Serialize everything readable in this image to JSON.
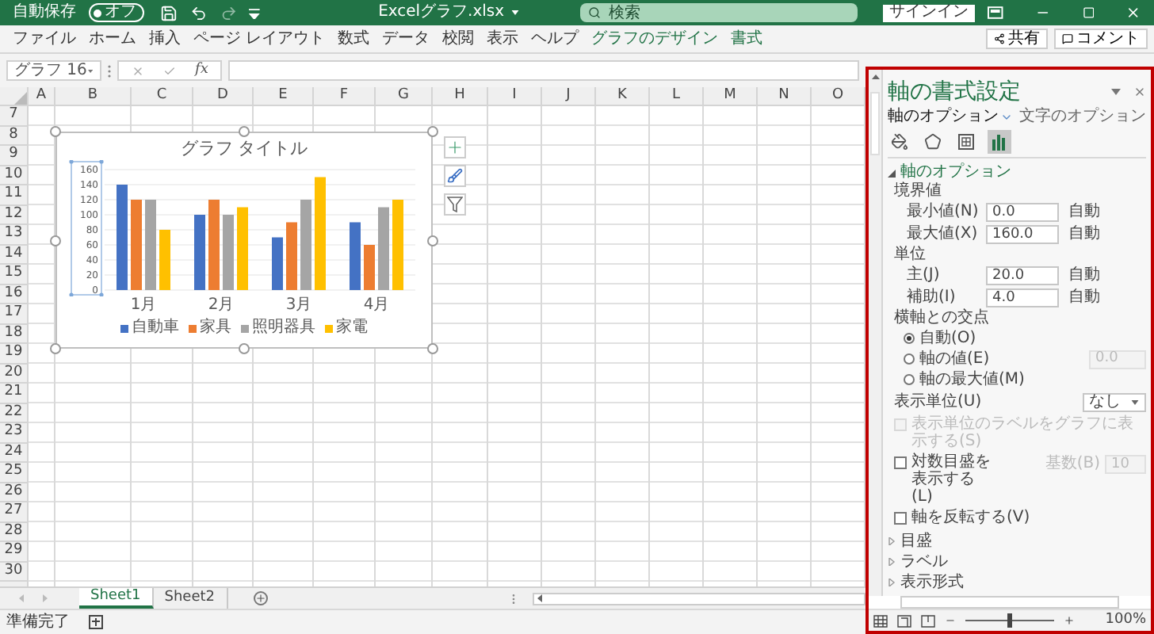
{
  "title_bar": {
    "autosave_label": "自動保存",
    "autosave_toggle": {
      "label": "オフ",
      "on": false
    },
    "filename": "Excelグラフ.xlsx",
    "search": {
      "placeholder": "検索"
    },
    "signin": "サインイン"
  },
  "ribbon": {
    "tabs": [
      {
        "label": "ファイル",
        "contextual": false
      },
      {
        "label": "ホーム",
        "contextual": false
      },
      {
        "label": "挿入",
        "contextual": false
      },
      {
        "label": "ページ レイアウト",
        "contextual": false
      },
      {
        "label": "数式",
        "contextual": false
      },
      {
        "label": "データ",
        "contextual": false
      },
      {
        "label": "校閲",
        "contextual": false
      },
      {
        "label": "表示",
        "contextual": false
      },
      {
        "label": "ヘルプ",
        "contextual": false
      },
      {
        "label": "グラフのデザイン",
        "contextual": true
      },
      {
        "label": "書式",
        "contextual": true
      }
    ],
    "share": "共有",
    "comment": "コメント"
  },
  "formula_bar": {
    "name_box": "グラフ 16",
    "function_label": "fx"
  },
  "sheet": {
    "columns": [
      "A",
      "B",
      "C",
      "D",
      "E",
      "F",
      "G",
      "H",
      "I",
      "J",
      "K",
      "L",
      "M",
      "N",
      "O"
    ],
    "rows": [
      "7",
      "8",
      "9",
      "10",
      "11",
      "12",
      "13",
      "14",
      "15",
      "16",
      "17",
      "18",
      "19",
      "20",
      "21",
      "22",
      "23",
      "24",
      "25",
      "26",
      "27",
      "28",
      "29",
      "30"
    ]
  },
  "chart": {
    "chart_data": {
      "type": "bar",
      "title": "グラフ タイトル",
      "categories": [
        "1月",
        "2月",
        "3月",
        "4月"
      ],
      "series": [
        {
          "name": "自動車",
          "color": "#4472c4",
          "values": [
            140,
            100,
            70,
            90
          ]
        },
        {
          "name": "家具",
          "color": "#ed7d31",
          "values": [
            120,
            120,
            90,
            60
          ]
        },
        {
          "name": "照明器具",
          "color": "#a5a5a5",
          "values": [
            120,
            100,
            120,
            110
          ]
        },
        {
          "name": "家電",
          "color": "#ffc000",
          "values": [
            80,
            110,
            150,
            120
          ]
        }
      ],
      "ylim": [
        0,
        160
      ],
      "yticks": [
        0,
        20,
        40,
        60,
        80,
        100,
        120,
        140,
        160
      ],
      "grid": true,
      "legend": true
    }
  },
  "sheet_tabs": [
    {
      "label": "Sheet1",
      "selected": true
    },
    {
      "label": "Sheet2",
      "selected": false
    }
  ],
  "status_bar": {
    "text": "準備完了",
    "zoom_label": "100%",
    "zoom_slider": {
      "level": 0.5
    }
  },
  "panel": {
    "title": "軸の書式設定",
    "tabs": [
      {
        "label": "軸のオプション",
        "selected": true
      },
      {
        "label": "文字のオプション",
        "selected": false
      }
    ],
    "icon_tabs": [
      {
        "selected": false
      },
      {
        "selected": false
      },
      {
        "selected": false
      },
      {
        "selected": true
      }
    ],
    "axis_options": {
      "title": "軸のオプション",
      "expanded": true,
      "bounds": {
        "heading": "境界値",
        "fields": [
          {
            "label": "最小値(N)",
            "value": "0.0",
            "reset": "自動"
          },
          {
            "label": "最大値(X)",
            "value": "160.0",
            "reset": "自動"
          }
        ]
      },
      "units": {
        "heading": "単位",
        "fields": [
          {
            "label": "主(J)",
            "value": "20.0",
            "reset": "自動"
          },
          {
            "label": "補助(I)",
            "value": "4.0",
            "reset": "自動"
          }
        ]
      },
      "crosses": {
        "heading": "横軸との交点",
        "options": [
          {
            "label": "自動(O)",
            "selected": true
          },
          {
            "label": "軸の値(E)",
            "selected": false,
            "value": "0.0"
          },
          {
            "label": "軸の最大値(M)",
            "selected": false
          }
        ]
      },
      "display_units": {
        "label": "表示単位(U)",
        "value": "なし"
      },
      "checkboxes": [
        {
          "label": "表示単位のラベルをグラフに表示する(S)",
          "checked": false,
          "disabled": true
        },
        {
          "label": "対数目盛を表示する(L)",
          "checked": false,
          "disabled": false,
          "base_label": "基数(B)",
          "base_value": "10"
        },
        {
          "label": "軸を反転する(V)",
          "checked": false,
          "disabled": false
        }
      ]
    },
    "collapsed_sections": [
      {
        "title": "目盛",
        "expanded": false
      },
      {
        "title": "ラベル",
        "expanded": false
      },
      {
        "title": "表示形式",
        "expanded": false
      }
    ]
  }
}
